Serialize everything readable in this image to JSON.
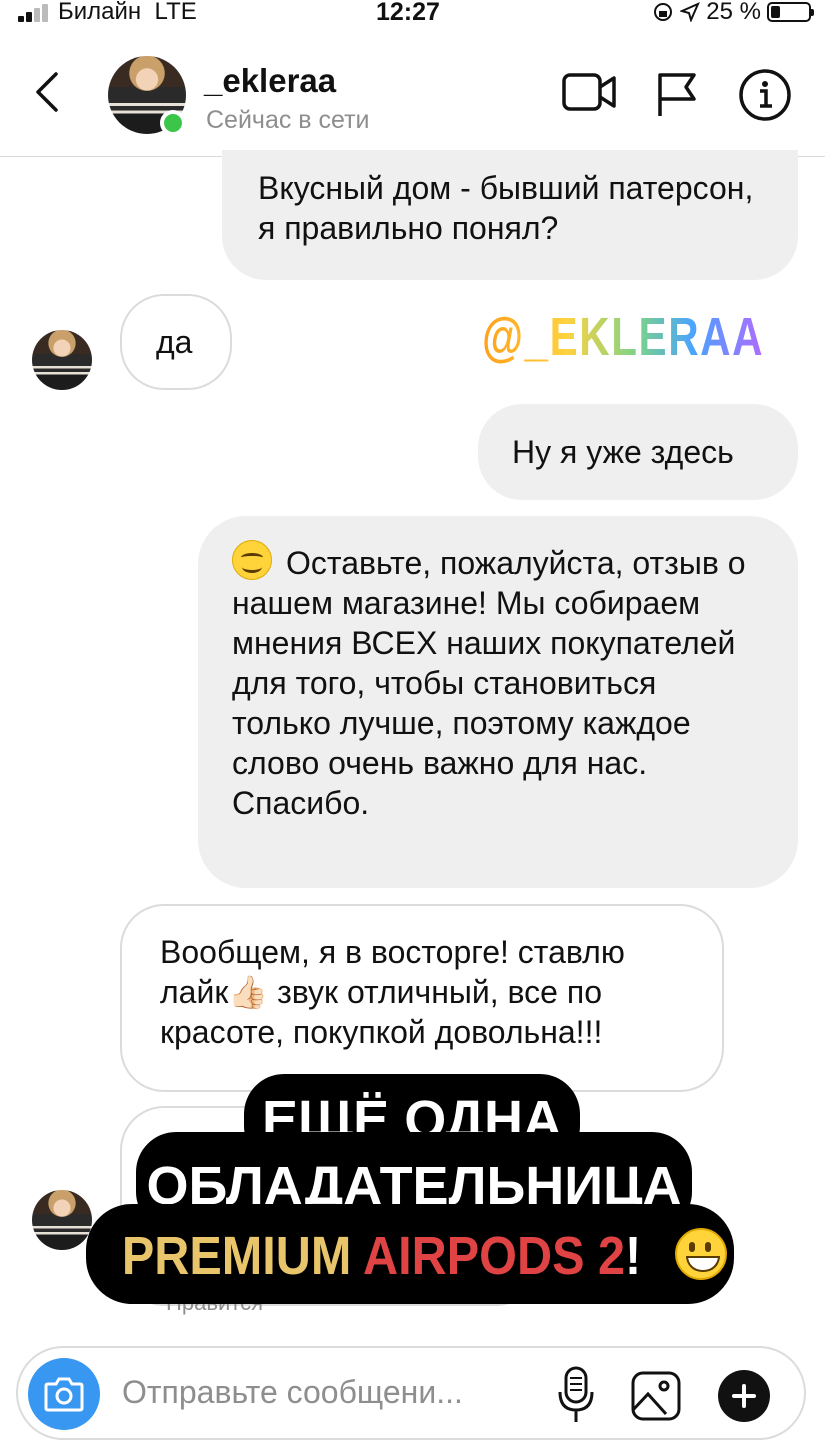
{
  "status_bar": {
    "carrier": "Билайн",
    "network": "LTE",
    "time": "12:27",
    "battery": "25 %"
  },
  "header": {
    "username": "_ekleraa",
    "presence": "Сейчас в сети"
  },
  "messages": [
    {
      "side": "outgoing",
      "text": "Вкусный дом - бывший патерсон, я правильно понял?"
    },
    {
      "side": "incoming",
      "text": "да"
    },
    {
      "side": "outgoing",
      "text": "Ну я уже здесь"
    },
    {
      "side": "outgoing",
      "text": "Оставьте, пожалуйста, отзыв о нашем магазине! Мы собираем мнения ВСЕХ наших покупателей для того, чтобы становиться только лучше, поэтому каждое слово очень важно для нас. Спасибо."
    },
    {
      "side": "incoming",
      "text": "Вообщем, я в восторге! ставлю лайк👍🏻 звук отличный, все по красоте, покупкой довольна!!!"
    }
  ],
  "liked_label": "Нравится",
  "watermark": "@_EKLERAA",
  "overlay": {
    "line1": "ЕЩЁ ОДНА",
    "line2": "ОБЛАДАТЕЛЬНИЦА",
    "line3_a": "PREMIUM",
    "line3_b": "AIRPODS 2",
    "line3_c": "!"
  },
  "composer": {
    "placeholder": "Отправьте сообщени..."
  },
  "colors": {
    "accent_blue": "#3897f0",
    "online_green": "#3bc64a",
    "outgoing_bubble": "#efefef",
    "overlay_gold": "#e8c46a",
    "overlay_red": "#e04343"
  },
  "icons": [
    "back-chevron-icon",
    "video-call-icon",
    "flag-icon",
    "info-icon",
    "camera-icon",
    "microphone-icon",
    "gallery-icon",
    "plus-icon"
  ]
}
